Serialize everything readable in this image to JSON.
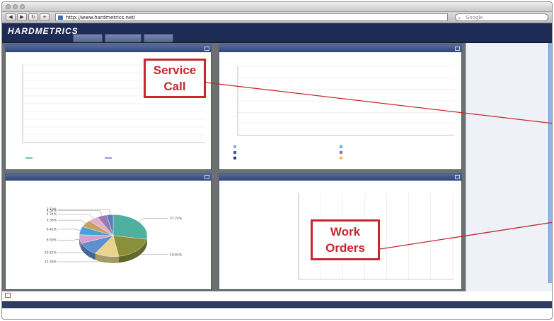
{
  "browser": {
    "url": "http://www.hardmetrics.net/",
    "search_placeholder": "Google"
  },
  "app": {
    "brand": "HARDMETRICS"
  },
  "callouts": {
    "service_call_line1": "Service",
    "service_call_line2": "Call",
    "work_orders_line1": "Work",
    "work_orders_line2": "Orders"
  },
  "colors": {
    "header": "#1e2c55",
    "panel_header": "#2f4577",
    "callout": "#c8262d",
    "teal": "#4fc1b0"
  },
  "chart_data": [
    {
      "type": "line",
      "x": [
        null,
        null,
        null,
        null,
        null,
        null,
        null,
        null,
        null,
        null,
        null,
        null
      ],
      "series": [
        {
          "values": [
            null,
            null,
            null,
            null,
            null,
            null,
            null,
            null,
            null,
            null,
            null,
            null
          ],
          "color": "#3fb8a2"
        },
        {
          "values": [
            null,
            null,
            null,
            null,
            null,
            null,
            null,
            null,
            null,
            null,
            null,
            null
          ],
          "color": "#7d83c2"
        }
      ],
      "grid": true,
      "legend": "bottom"
    },
    {
      "type": "bar",
      "stacked": true,
      "categories": [
        null,
        null,
        null,
        null,
        null,
        null,
        null,
        null,
        null,
        null,
        null,
        null,
        null
      ],
      "series": [
        {
          "values": [
            null,
            null,
            null,
            null,
            null,
            null,
            null,
            null,
            null,
            null,
            null,
            null,
            null
          ],
          "color": "#8fa5d8"
        },
        {
          "values": [
            null,
            null,
            null,
            null,
            null,
            null,
            null,
            null,
            null,
            null,
            null,
            null,
            null
          ],
          "color": "#2f5aa8"
        },
        {
          "values": [
            null,
            null,
            null,
            null,
            null,
            null,
            null,
            null,
            null,
            null,
            null,
            null,
            null
          ],
          "color": "#1d3d7e"
        },
        {
          "values": [
            null,
            null,
            null,
            null,
            null,
            null,
            null,
            null,
            null,
            null,
            null,
            null,
            null
          ],
          "color": "#4fc1c0"
        },
        {
          "values": [
            null,
            null,
            null,
            null,
            null,
            null,
            null,
            null,
            null,
            null,
            null,
            null,
            null
          ],
          "color": "#8c6ab8"
        }
      ],
      "legend": "bottom"
    },
    {
      "type": "pie",
      "slices": [
        {
          "value": 27.74,
          "color": "#4fb0a0"
        },
        {
          "value": 19.65,
          "color": "#8a8f3a"
        },
        {
          "value": 11.56,
          "color": "#e8d48a"
        },
        {
          "value": 10.12,
          "color": "#5f8fcf"
        },
        {
          "value": 6.59,
          "color": "#d4a0d0"
        },
        {
          "value": 6.42,
          "color": "#4a9fd4"
        },
        {
          "value": 5.56,
          "color": "#c8a060"
        },
        {
          "value": 4.74,
          "color": "#e0b0c8"
        },
        {
          "value": 4.52,
          "color": "#9a7ab0"
        },
        {
          "value": 3.1,
          "color": "#5a7fbf"
        }
      ]
    },
    {
      "type": "bar",
      "orientation": "horizontal",
      "categories": [
        null,
        null,
        null,
        null,
        null,
        null,
        null,
        null,
        null,
        null,
        null,
        null
      ],
      "values": [
        null,
        null,
        null,
        null,
        null,
        null,
        null,
        null,
        null,
        null,
        null,
        null
      ],
      "color": "#4fc1b0",
      "grid": true
    }
  ]
}
